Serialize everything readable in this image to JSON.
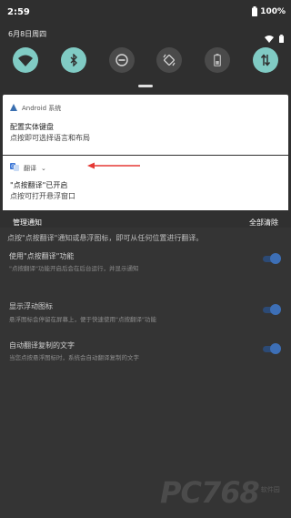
{
  "status_bar": {
    "time": "2:59",
    "battery": "100%"
  },
  "quick_settings": {
    "date": "6月8日周四",
    "tiles": [
      {
        "icon": "wifi-icon",
        "state": "on"
      },
      {
        "icon": "bluetooth-icon",
        "state": "on"
      },
      {
        "icon": "do-not-disturb-icon",
        "state": "off"
      },
      {
        "icon": "auto-rotate-icon",
        "state": "off"
      },
      {
        "icon": "battery-saver-icon",
        "state": "off"
      },
      {
        "icon": "mobile-data-icon",
        "state": "on"
      }
    ],
    "accent_color": "#80cbc4"
  },
  "notifications": [
    {
      "app": "Android 系统",
      "title": "配置实体键盘",
      "text": "点按即可选择语言和布局"
    },
    {
      "app": "翻译",
      "title": "\"点按翻译\"已开启",
      "text": "点按可打开悬浮窗口"
    }
  ],
  "footer": {
    "manage": "管理通知",
    "clear_all": "全部清除"
  },
  "background_app": {
    "intro": "点按\"点按翻译\"通知或悬浮图标，即可从任何位置进行翻译。",
    "settings": [
      {
        "title": "使用\"点按翻译\"功能",
        "sub": "\"点按翻译\"功能开启后会在后台运行，并显示通知",
        "enabled": true
      },
      {
        "title": "显示浮动图标",
        "sub": "悬浮图标会停留在屏幕上，便于快速使用\"点按翻译\"功能",
        "enabled": true
      },
      {
        "title": "自动翻译复制的文字",
        "sub": "当您点按悬浮图标时，系统会自动翻译复制的文字",
        "enabled": true
      }
    ]
  },
  "watermark": {
    "main": "PC768",
    "sub": "软件园"
  }
}
